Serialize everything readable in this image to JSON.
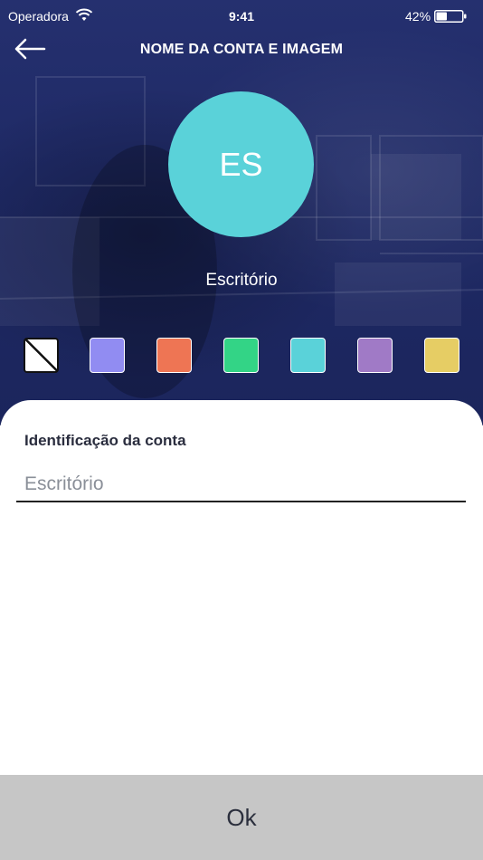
{
  "status_bar": {
    "carrier": "Operadora",
    "time": "9:41",
    "battery_percent": "42%",
    "battery_level": 0.42,
    "wifi_icon": "wifi-icon",
    "battery_icon": "battery-icon"
  },
  "header": {
    "title": "NOME DA CONTA E IMAGEM",
    "back_icon": "arrow-left-icon"
  },
  "avatar": {
    "initials": "ES",
    "color": "#5ad2d9"
  },
  "account_name": "Escritório",
  "swatches": [
    {
      "name": "none",
      "color": "#ffffff",
      "selected": true
    },
    {
      "name": "periwinkle",
      "color": "#918cf2"
    },
    {
      "name": "coral",
      "color": "#ee7554"
    },
    {
      "name": "green",
      "color": "#33d486"
    },
    {
      "name": "cyan",
      "color": "#5ad2d9"
    },
    {
      "name": "lavender",
      "color": "#a07ac6"
    },
    {
      "name": "mustard",
      "color": "#e6cd64"
    }
  ],
  "form": {
    "label": "Identificação da conta",
    "placeholder": "Escritório",
    "value": ""
  },
  "ok_button": "Ok",
  "colors": {
    "header_bg": "#25306f",
    "button_bg": "#c6c6c6"
  }
}
